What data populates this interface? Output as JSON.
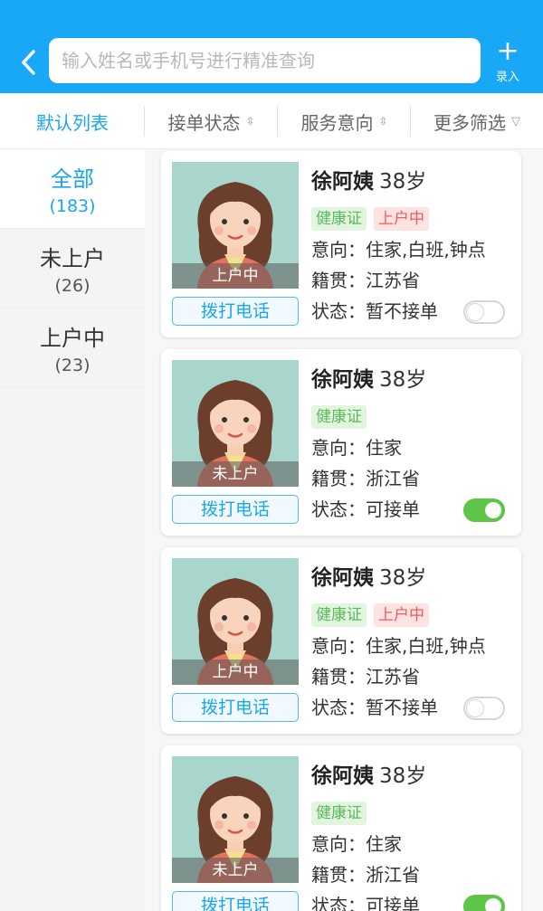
{
  "header": {
    "search_placeholder": "输入姓名或手机号进行精准查询",
    "add_label": "录入"
  },
  "filters": {
    "default": "默认列表",
    "order_status": "接单状态",
    "service_intent": "服务意向",
    "more": "更多筛选"
  },
  "sidebar": {
    "items": [
      {
        "name": "全部",
        "count": "(183)"
      },
      {
        "name": "未上户",
        "count": "(26)"
      },
      {
        "name": "上户中",
        "count": "(23)"
      }
    ]
  },
  "cards": [
    {
      "name": "徐阿姨",
      "age": "38岁",
      "tag1": "健康证",
      "tag2": "上户中",
      "intent_label": "意向：",
      "intent": "住家,白班,钟点",
      "origin_label": "籍贯：",
      "origin": "江苏省",
      "status_label": "状态：",
      "status": "暂不接单",
      "stamp": "上户中",
      "call": "拨打电话",
      "toggle_on": false
    },
    {
      "name": "徐阿姨",
      "age": "38岁",
      "tag1": "健康证",
      "tag2": "",
      "intent_label": "意向：",
      "intent": "住家",
      "origin_label": "籍贯：",
      "origin": "浙江省",
      "status_label": "状态：",
      "status": "可接单",
      "stamp": "未上户",
      "call": "拨打电话",
      "toggle_on": true
    },
    {
      "name": "徐阿姨",
      "age": "38岁",
      "tag1": "健康证",
      "tag2": "上户中",
      "intent_label": "意向：",
      "intent": "住家,白班,钟点",
      "origin_label": "籍贯：",
      "origin": "江苏省",
      "status_label": "状态：",
      "status": "暂不接单",
      "stamp": "上户中",
      "call": "拨打电话",
      "toggle_on": false
    },
    {
      "name": "徐阿姨",
      "age": "38岁",
      "tag1": "健康证",
      "tag2": "",
      "intent_label": "意向：",
      "intent": "住家",
      "origin_label": "籍贯：",
      "origin": "浙江省",
      "status_label": "状态：",
      "status": "可接单",
      "stamp": "未上户",
      "call": "拨打电话",
      "toggle_on": true
    }
  ]
}
